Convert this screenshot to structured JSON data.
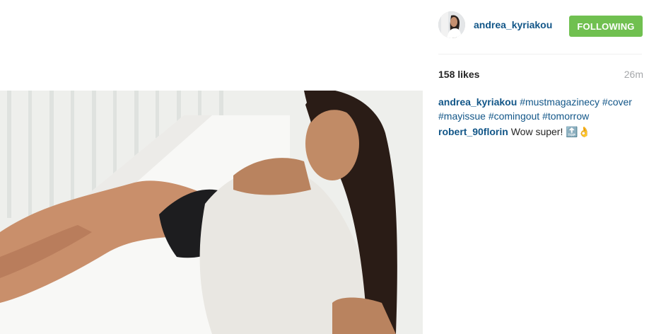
{
  "post": {
    "username": "andrea_kyriakou",
    "follow_label": "FOLLOWING",
    "likes": "158 likes",
    "time_ago": "26m"
  },
  "caption": {
    "user": "andrea_kyriakou",
    "tags": [
      "#mustmagazinecy",
      "#cover",
      "#mayissue",
      "#comingout",
      "#tomorrow"
    ]
  },
  "comment": {
    "user": "robert_90florin",
    "text": "Wow super! 🔝👌"
  },
  "colors": {
    "link": "#125688",
    "follow_button": "#70c050",
    "muted": "#a5a7aa"
  },
  "icons": [
    "avatar-image",
    "post-photo"
  ]
}
